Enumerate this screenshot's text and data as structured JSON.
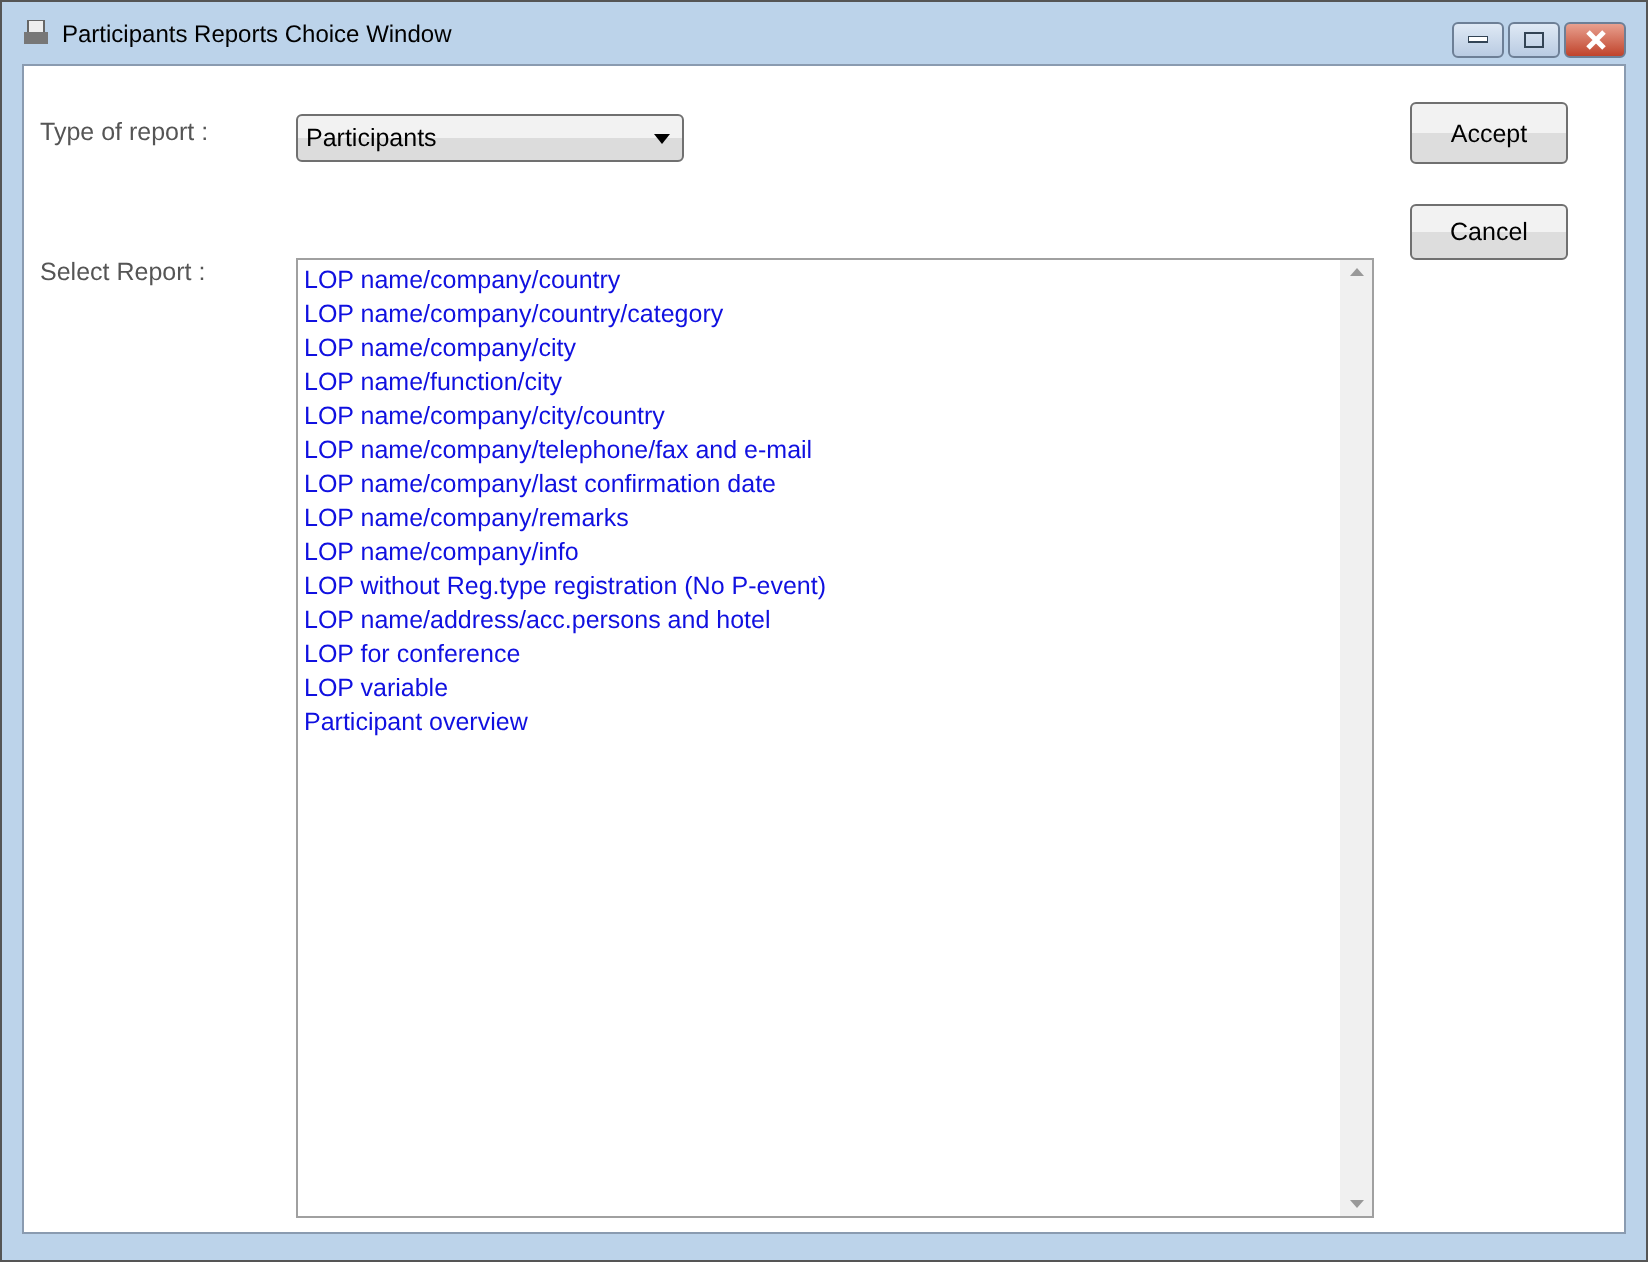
{
  "window": {
    "title": "Participants Reports Choice Window"
  },
  "type_of_report": {
    "label": "Type of report :",
    "value": "Participants"
  },
  "select_report": {
    "label": "Select Report :",
    "items": [
      {
        "label": "LOP name/company/country",
        "selected": false
      },
      {
        "label": "LOP name/company/country/category",
        "selected": false
      },
      {
        "label": "LOP name/company/city",
        "selected": false
      },
      {
        "label": "LOP name/function/city",
        "selected": false
      },
      {
        "label": "LOP name/company/city/country",
        "selected": false
      },
      {
        "label": "LOP name/company/telephone/fax and e-mail",
        "selected": false
      },
      {
        "label": "LOP name/company/last confirmation date",
        "selected": false
      },
      {
        "label": "LOP name/company/remarks",
        "selected": false
      },
      {
        "label": "LOP name/company/info",
        "selected": false
      },
      {
        "label": "LOP without Reg.type registration (No P-event)",
        "selected": false
      },
      {
        "label": "LOP name/address/acc.persons and hotel",
        "selected": false
      },
      {
        "label": "LOP for conference",
        "selected": false
      },
      {
        "label": "LOP variable",
        "selected": false
      },
      {
        "label": "Participant overview",
        "selected": false
      }
    ]
  },
  "buttons": [
    {
      "label": "Accept"
    },
    {
      "label": "Cancel"
    }
  ]
}
